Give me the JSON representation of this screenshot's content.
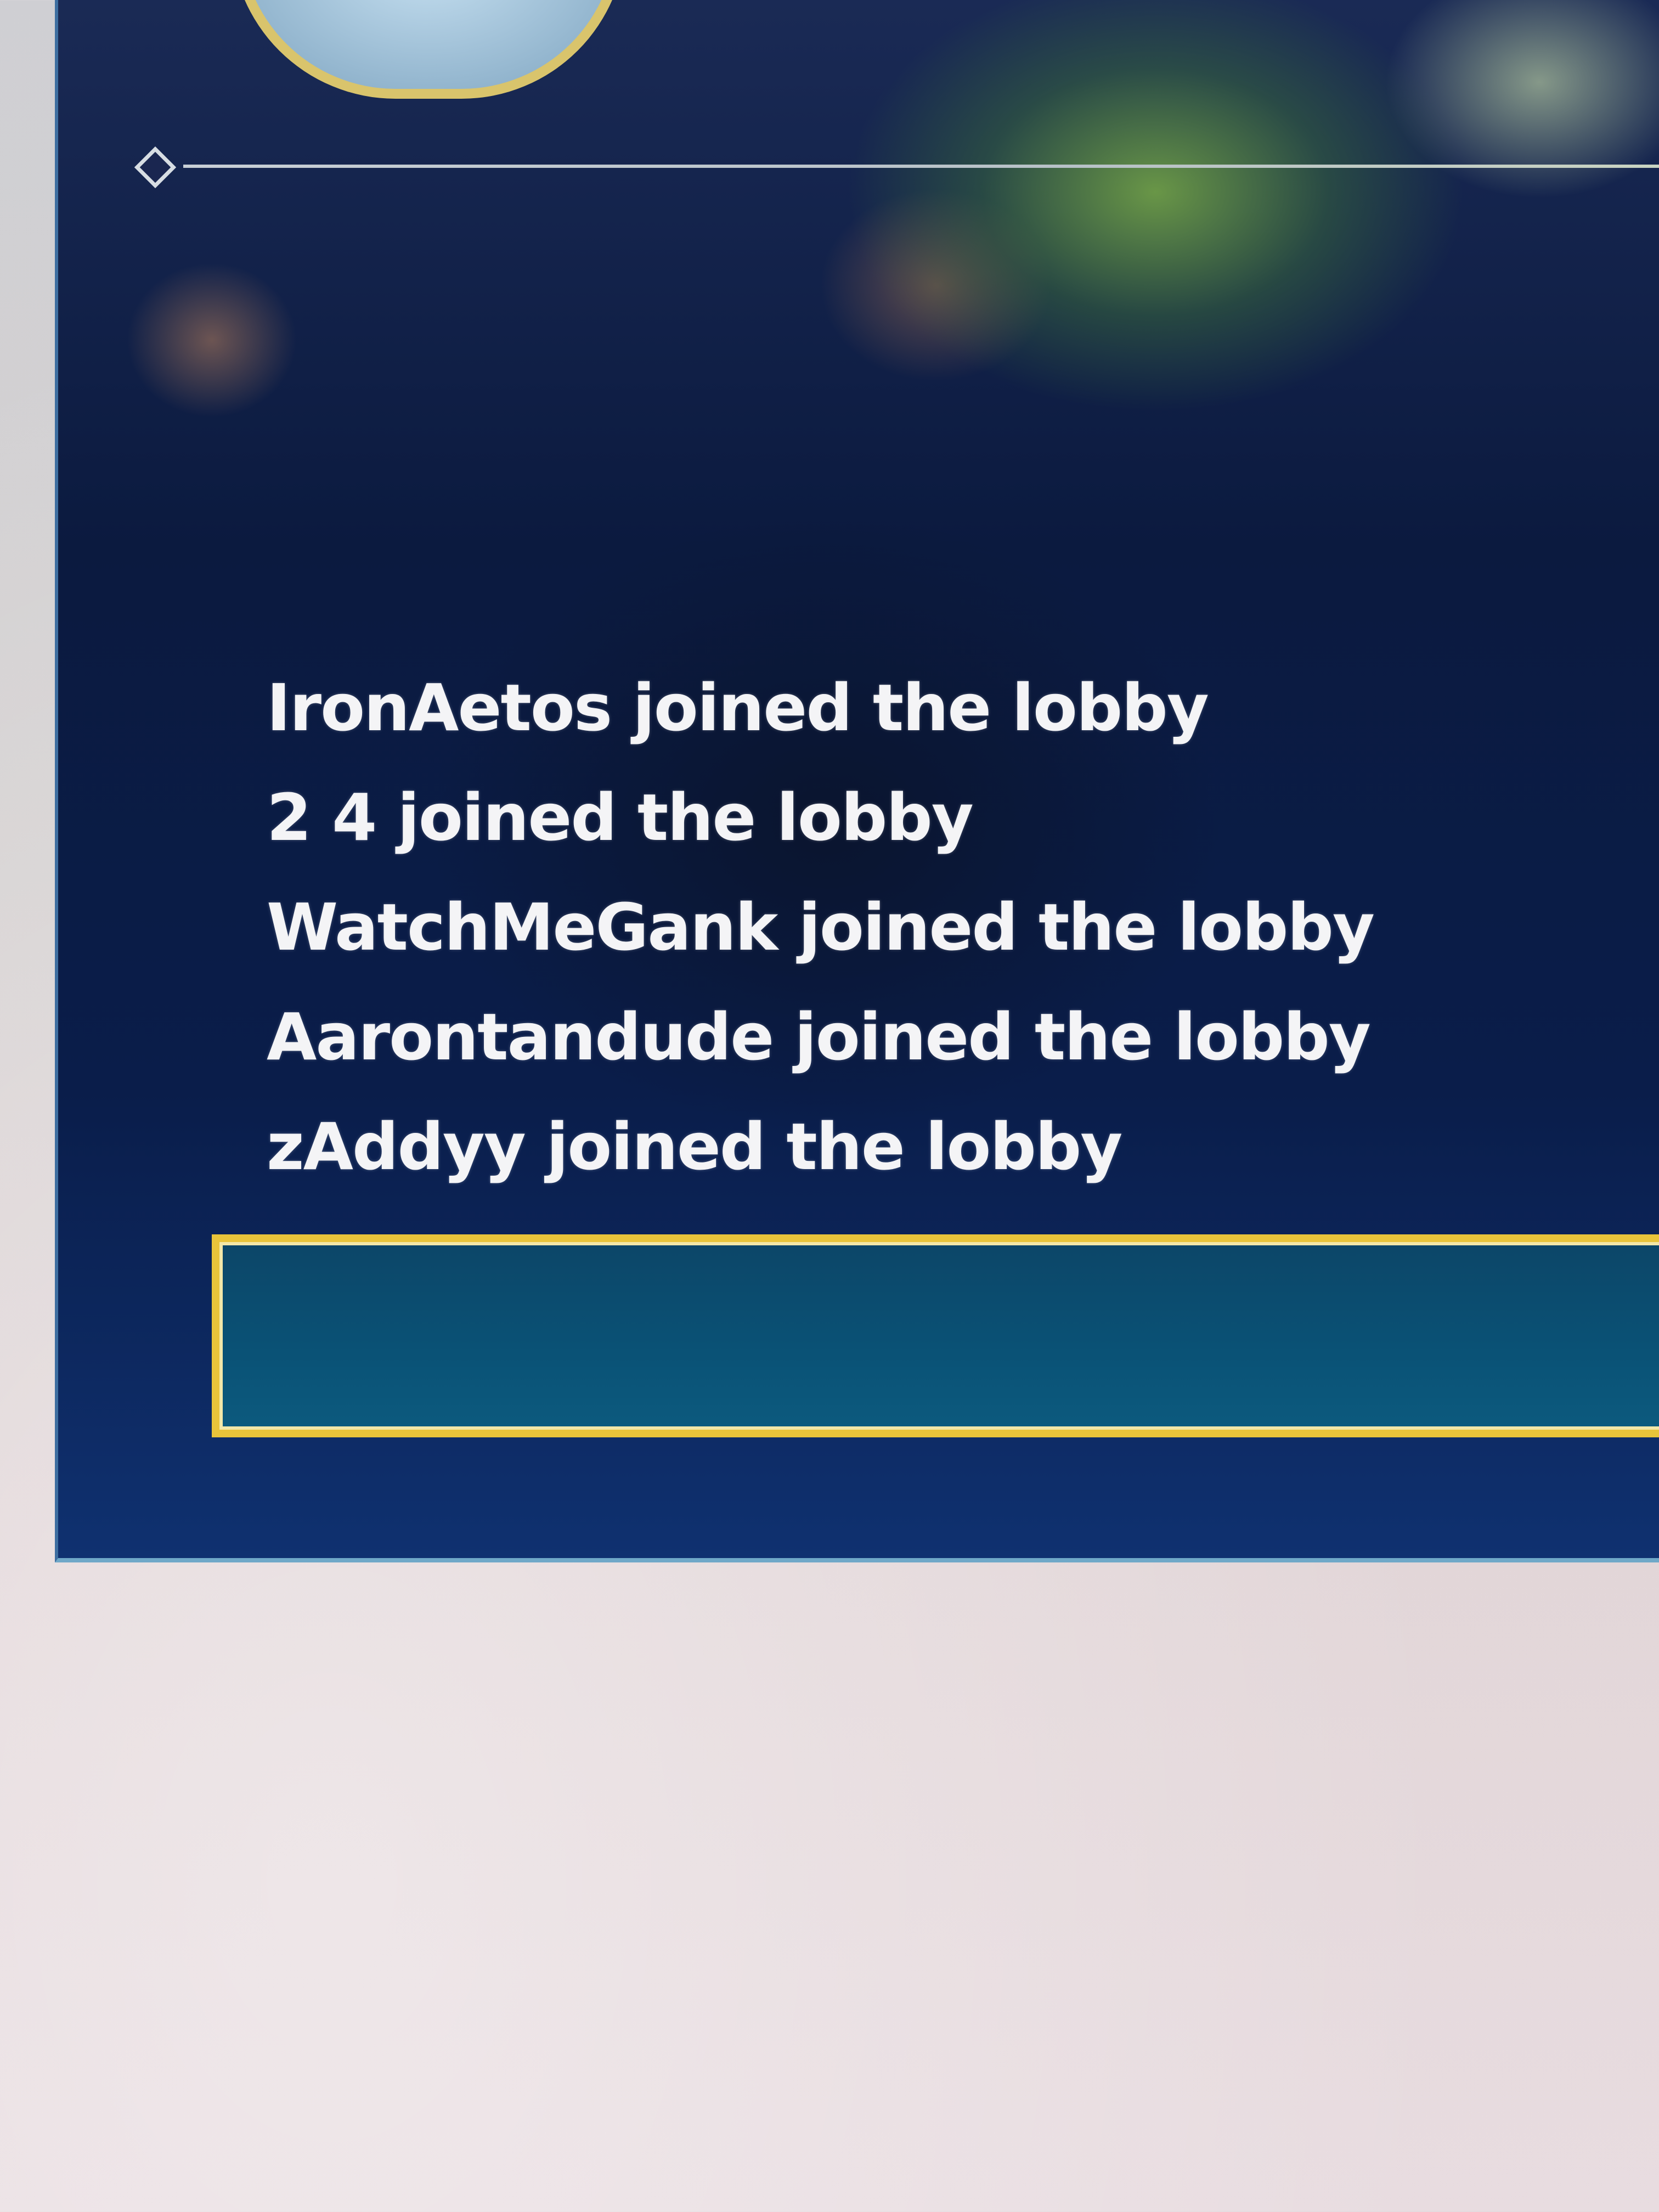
{
  "chat": {
    "messages": [
      {
        "text": "IronAetos joined the lobby"
      },
      {
        "text": "2 4 joined the lobby"
      },
      {
        "text": "WatchMeGank joined the lobby"
      },
      {
        "text": "Aarontandude joined the lobby"
      },
      {
        "text": "zAddyy joined the lobby"
      }
    ],
    "input_value": ""
  },
  "colors": {
    "panel_background": "#0b1a3f",
    "input_border": "#e9c43a",
    "input_background": "#0a5276",
    "message_text": "#f4f4f6"
  },
  "icons": {
    "divider_ornament": "diamond-icon",
    "profile_frame": "avatar-ring"
  }
}
